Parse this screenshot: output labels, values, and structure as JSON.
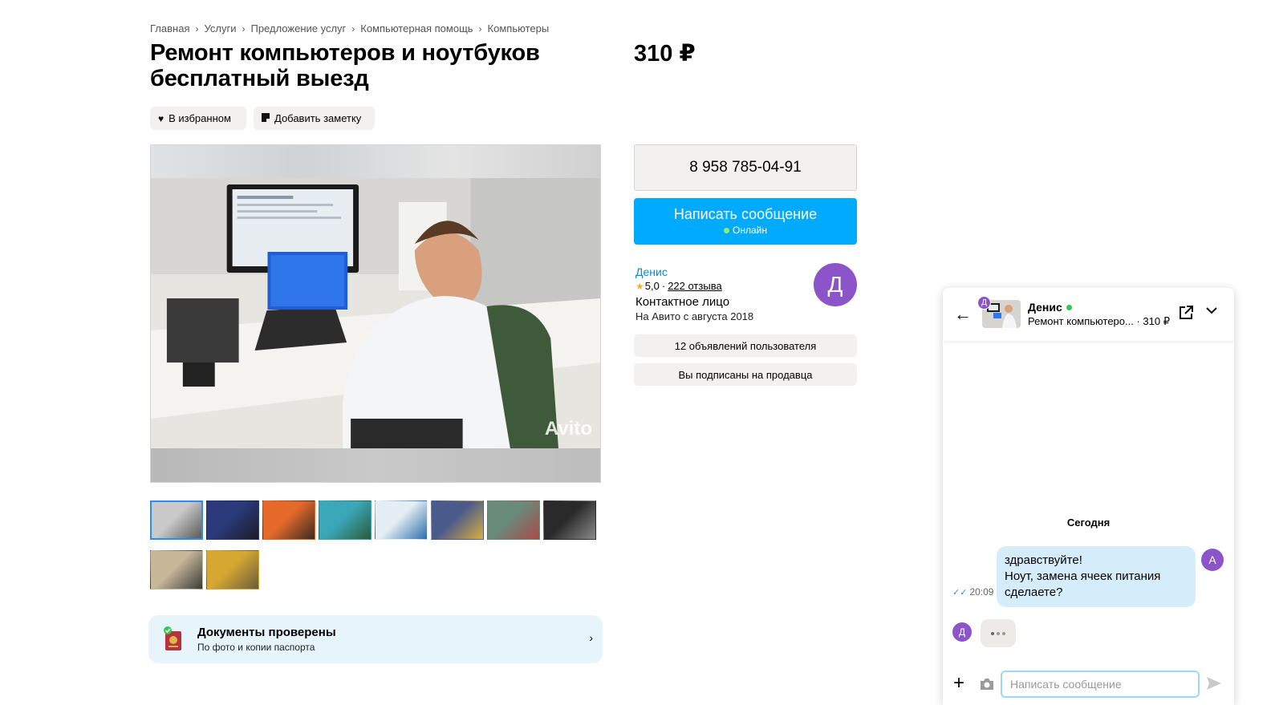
{
  "breadcrumb": [
    "Главная",
    "Услуги",
    "Предложение услуг",
    "Компьютерная помощь",
    "Компьютеры"
  ],
  "breadcrumb_sep": "›",
  "listing": {
    "title_line1": "Ремонт компьютеров и ноутбуков",
    "title_line2": "бесплатный выезд",
    "price": "310 ₽"
  },
  "actions": {
    "favorite_label": "В избранном",
    "note_label": "Добавить заметку"
  },
  "photo": {
    "watermark": "Avito",
    "thumbnails": [
      {
        "name": "technician-at-desk",
        "colors": [
          "#c9c9c9",
          "#5a5a5a"
        ]
      },
      {
        "name": "laptop-blue-screen",
        "colors": [
          "#2a3a7a",
          "#1b1b24"
        ]
      },
      {
        "name": "pc-case-orange",
        "colors": [
          "#e56a2a",
          "#3a2a22"
        ]
      },
      {
        "name": "monitors-landscape",
        "colors": [
          "#3aa8b8",
          "#2a5a3a"
        ]
      },
      {
        "name": "tablet-box",
        "colors": [
          "#e6eef5",
          "#2d6fa8"
        ]
      },
      {
        "name": "laptop-desk",
        "colors": [
          "#4a5a8a",
          "#d8b040"
        ]
      },
      {
        "name": "motherboard",
        "colors": [
          "#6a8a7a",
          "#a84a4a"
        ]
      },
      {
        "name": "pc-internals",
        "colors": [
          "#2a2a2a",
          "#8a8a8a"
        ]
      },
      {
        "name": "laptop-opened",
        "colors": [
          "#c8b89a",
          "#3a3a3a"
        ]
      },
      {
        "name": "workbench",
        "colors": [
          "#d6a832",
          "#6a5a3a"
        ]
      }
    ]
  },
  "documents": {
    "title": "Документы проверены",
    "subtitle": "По фото и копии паспорта",
    "chevron": "›"
  },
  "contact": {
    "phone": "8 958 785-04-91",
    "message_label": "Написать сообщение",
    "online_label": "Онлайн"
  },
  "seller": {
    "name": "Денис",
    "rating": "5,0",
    "rating_sep": "·",
    "reviews": "222 отзыва",
    "role": "Контактное лицо",
    "since": "На Авито с августа 2018",
    "avatar_letter": "Д",
    "ads_label": "12 объявлений пользователя",
    "subscribed_label": "Вы подписаны на продавца"
  },
  "chat": {
    "name": "Денис",
    "item_title": "Ремонт компьютеро... · 310 ₽",
    "badge_letter": "Д",
    "date_label": "Сегодня",
    "message_lines": [
      "здравствуйте!",
      "Ноут, замена ячеек питания",
      "сделаете?"
    ],
    "message_time": "20:09",
    "my_avatar_letter": "А",
    "peer_avatar_letter": "Д",
    "input_placeholder": "Написать сообщение"
  },
  "colors": {
    "accent_blue": "#00aaff",
    "link_blue": "#0a8bd6",
    "avatar_purple": "#8b54c9",
    "online_green": "#2fca4f",
    "bubble_blue": "#d5ecfb",
    "docs_bg": "#e7f4fb"
  }
}
